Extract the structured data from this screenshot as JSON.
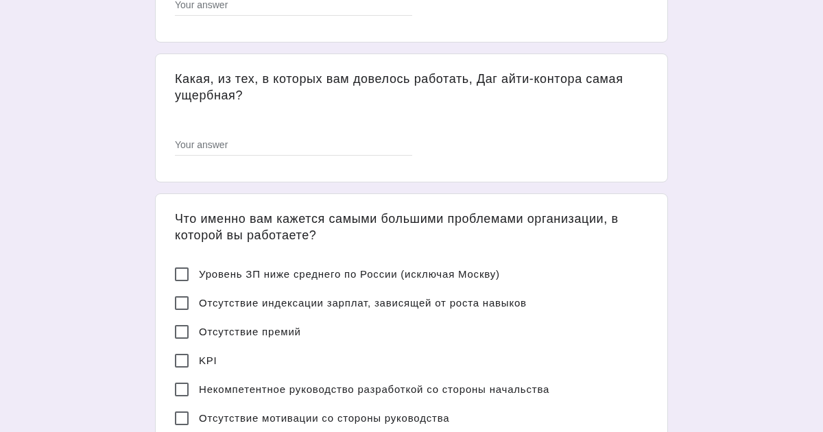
{
  "questions": [
    {
      "kind": "text",
      "answer": {
        "placeholder": "Your answer"
      }
    },
    {
      "kind": "text",
      "title": "Какая, из тех, в которых вам довелось работать, Даг айти-контора самая ущербная?",
      "answer": {
        "placeholder": "Your answer"
      }
    },
    {
      "kind": "checkboxes",
      "title": "Что именно вам кажется самыми большими проблемами организации, в которой вы работаете?",
      "options": [
        {
          "label": "Уровень ЗП ниже среднего по России (исключая Москву)",
          "checked": false
        },
        {
          "label": "Отсутствие индексации зарплат, зависящей от роста навыков",
          "checked": false
        },
        {
          "label": "Отсутствие премий",
          "checked": false
        },
        {
          "label": "KPI",
          "checked": false
        },
        {
          "label": "Некомпетентное руководство разработкой со стороны начальства",
          "checked": false
        },
        {
          "label": "Отсутствие мотивации со стороны руководства",
          "checked": false
        }
      ]
    }
  ]
}
